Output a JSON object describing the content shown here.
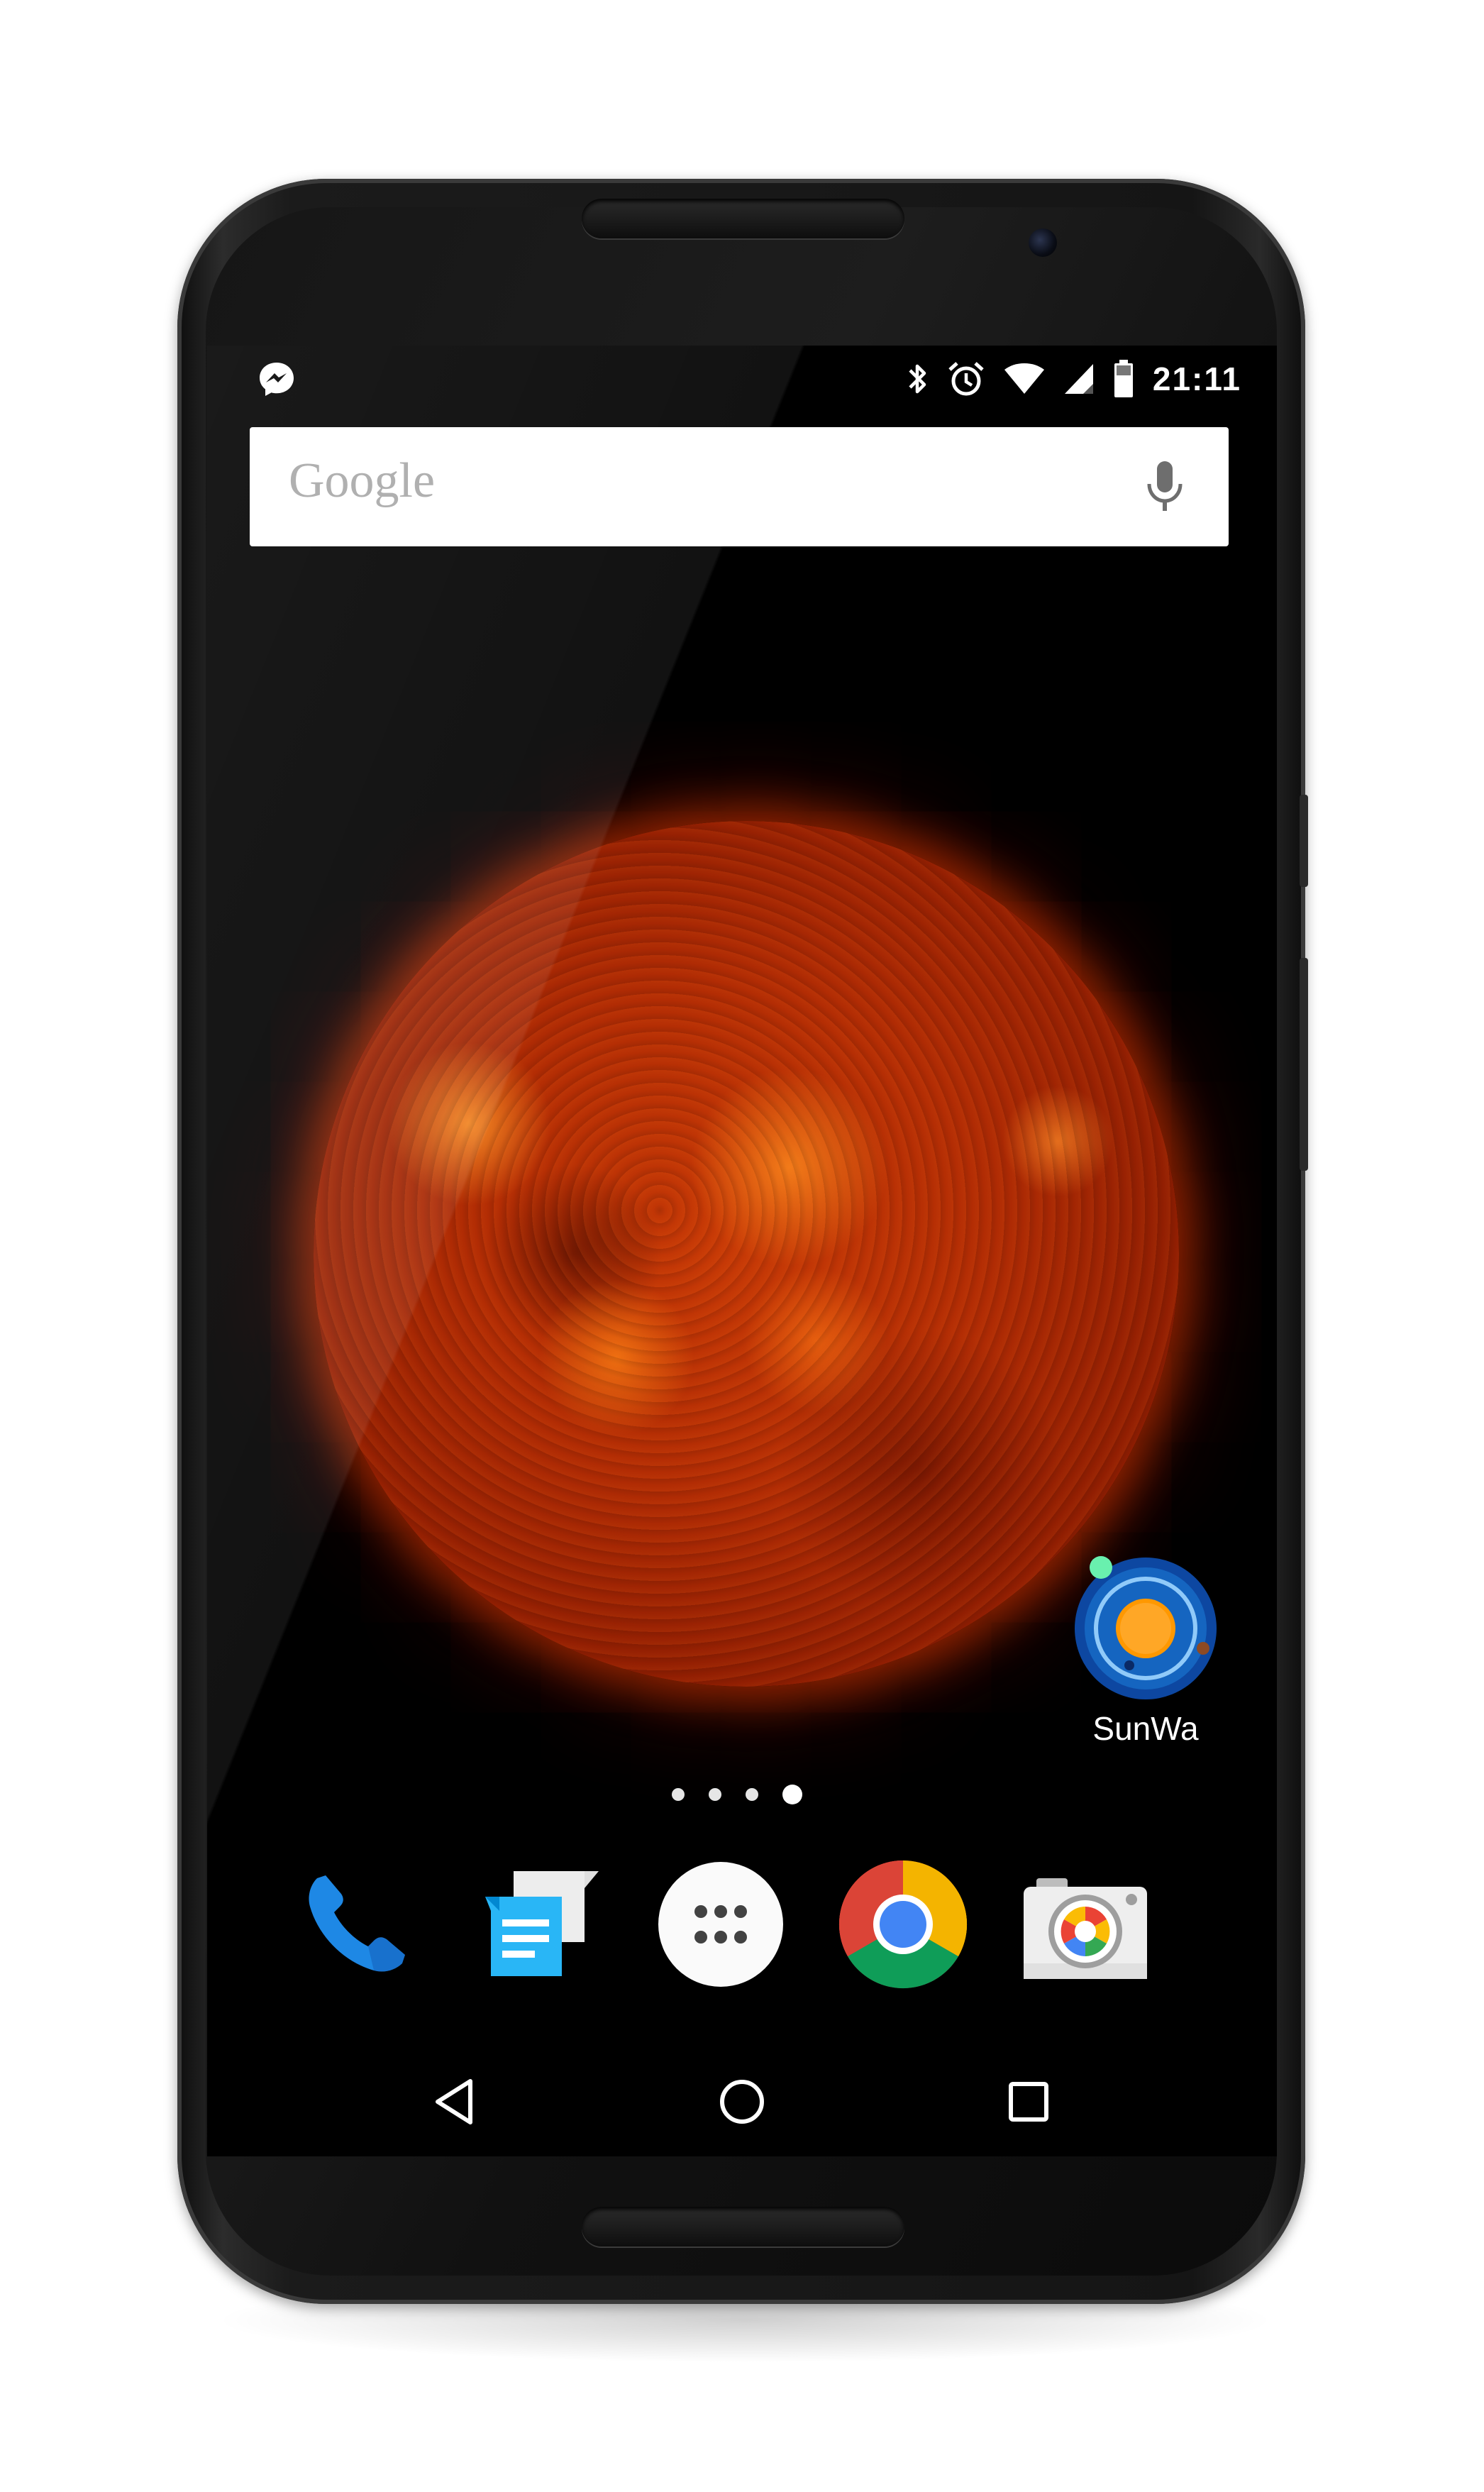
{
  "status_bar": {
    "time": "21:11",
    "left_icon": "messenger-icon",
    "right_icons": [
      "bluetooth-icon",
      "alarm-icon",
      "wifi-icon",
      "signal-icon",
      "battery-icon"
    ]
  },
  "search_bar": {
    "logo_text": "Google",
    "mic_icon": "mic-icon"
  },
  "wallpaper": {
    "subject": "sun",
    "color": "#c83a06"
  },
  "home_apps": [
    {
      "label": "SunWa",
      "icon": "sunwa-app-icon"
    }
  ],
  "page_indicator": {
    "pages": 4,
    "current": 4
  },
  "dock": [
    {
      "icon": "phone-icon",
      "color": "#1e88e5"
    },
    {
      "icon": "messenger-app-icon",
      "color": "#29b6f6"
    },
    {
      "icon": "app-drawer-icon",
      "color": "#ffffff"
    },
    {
      "icon": "chrome-icon",
      "color": "#4285f4"
    },
    {
      "icon": "camera-icon",
      "color": "#eeeeee"
    }
  ],
  "nav_bar": {
    "buttons": [
      "back-icon",
      "home-icon",
      "recents-icon"
    ]
  }
}
